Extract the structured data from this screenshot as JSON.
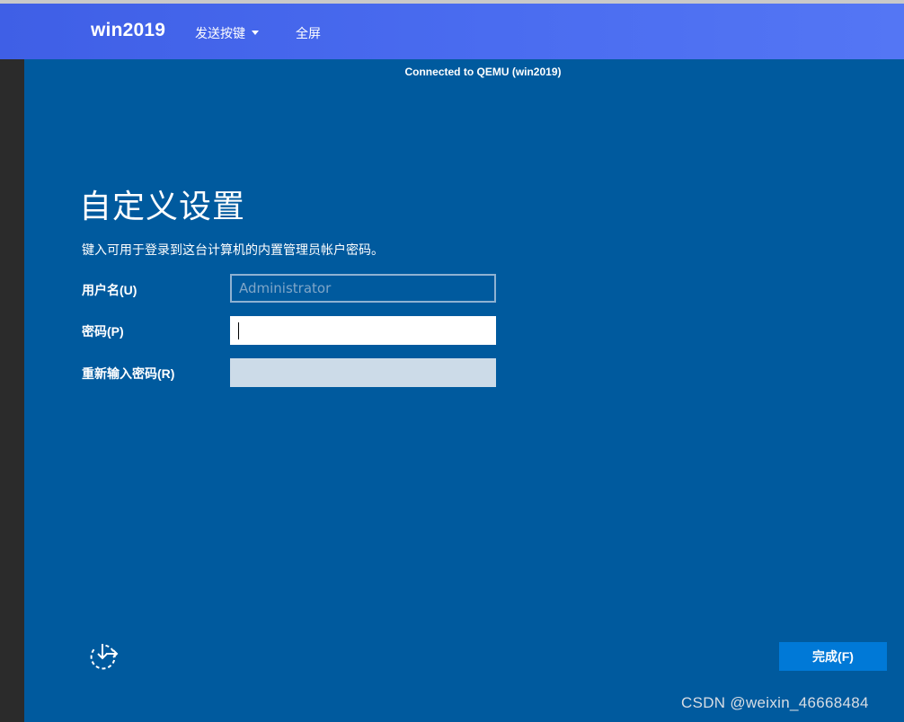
{
  "navbar": {
    "brand": "win2019",
    "send_keys": "发送按键",
    "fullscreen": "全屏"
  },
  "vm": {
    "status": "Connected to QEMU (win2019)",
    "title": "自定义设置",
    "description": "键入可用于登录到这台计算机的内置管理员帐户密码。",
    "fields": {
      "username_label": "用户名(U)",
      "username_value": "Administrator",
      "password_label": "密码(P)",
      "reenter_label": "重新输入密码(R)"
    },
    "finish_button": "完成(F)",
    "accessibility_icon": "ease-of-access-icon"
  },
  "watermark": "CSDN @weixin_46668484",
  "colors": {
    "navbar": "#4a6cf0",
    "screen": "#005a9e",
    "button": "#0079d7"
  }
}
